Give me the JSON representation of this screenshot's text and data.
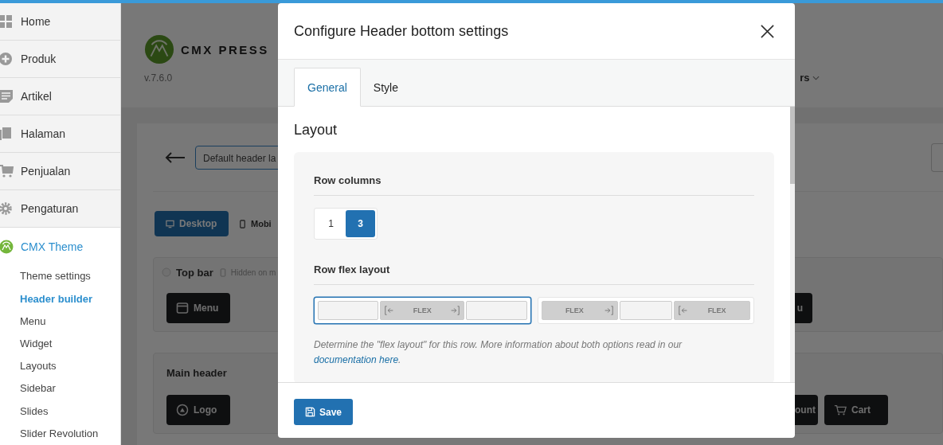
{
  "sidebar": {
    "items": [
      {
        "label": "Home",
        "selected": false
      },
      {
        "label": "Produk",
        "selected": false
      },
      {
        "label": "Artikel",
        "selected": false
      },
      {
        "label": "Halaman",
        "selected": false
      },
      {
        "label": "Penjualan",
        "selected": false
      },
      {
        "label": "Pengaturan",
        "selected": false
      },
      {
        "label": "CMX Theme",
        "selected": true
      }
    ],
    "subitems": [
      {
        "label": "Theme settings",
        "selected": false
      },
      {
        "label": "Header builder",
        "selected": true
      },
      {
        "label": "Menu",
        "selected": false
      },
      {
        "label": "Widget",
        "selected": false
      },
      {
        "label": "Layouts",
        "selected": false
      },
      {
        "label": "Sidebar",
        "selected": false
      },
      {
        "label": "Slides",
        "selected": false
      },
      {
        "label": "Slider Revolution",
        "selected": false
      }
    ]
  },
  "background": {
    "brand": "CMX PRESS",
    "version": "v.7.6.0",
    "nav_item": "rs",
    "layout_name": "Default header la",
    "device_tabs": [
      {
        "label": "Desktop",
        "selected": true
      },
      {
        "label": "Mobi",
        "selected": false
      }
    ],
    "sections": [
      {
        "title": "Top bar",
        "note": "Hidden on m",
        "left_button": "Menu",
        "right_buttons": [
          "u"
        ]
      },
      {
        "title": "Main header",
        "left_button": "Logo",
        "right_buttons": [
          "ount",
          "Cart"
        ]
      }
    ]
  },
  "dialog": {
    "title": "Configure Header bottom settings",
    "tabs": [
      {
        "label": "General",
        "selected": true
      },
      {
        "label": "Style",
        "selected": false
      }
    ],
    "section_title": "Layout",
    "row_columns": {
      "label": "Row columns",
      "options": [
        {
          "label": "1",
          "selected": false
        },
        {
          "label": "3",
          "selected": true
        }
      ]
    },
    "row_flex_layout": {
      "label": "Row flex layout",
      "options": [
        {
          "selected": true,
          "cells": [
            {
              "kind": "empty"
            },
            {
              "kind": "flex",
              "label": "FLEX",
              "arrow_left": true,
              "arrow_right": true
            },
            {
              "kind": "empty"
            }
          ]
        },
        {
          "selected": false,
          "cells": [
            {
              "kind": "flex",
              "label": "FLEX",
              "arrow_left": false,
              "arrow_right": true
            },
            {
              "kind": "empty"
            },
            {
              "kind": "flex",
              "label": "FLEX",
              "arrow_left": true,
              "arrow_right": false
            }
          ]
        }
      ],
      "help": "Determine the \"flex layout\" for this row. More information about both options read in our",
      "link": "documentation here",
      "help_end": "."
    },
    "save": "Save"
  }
}
